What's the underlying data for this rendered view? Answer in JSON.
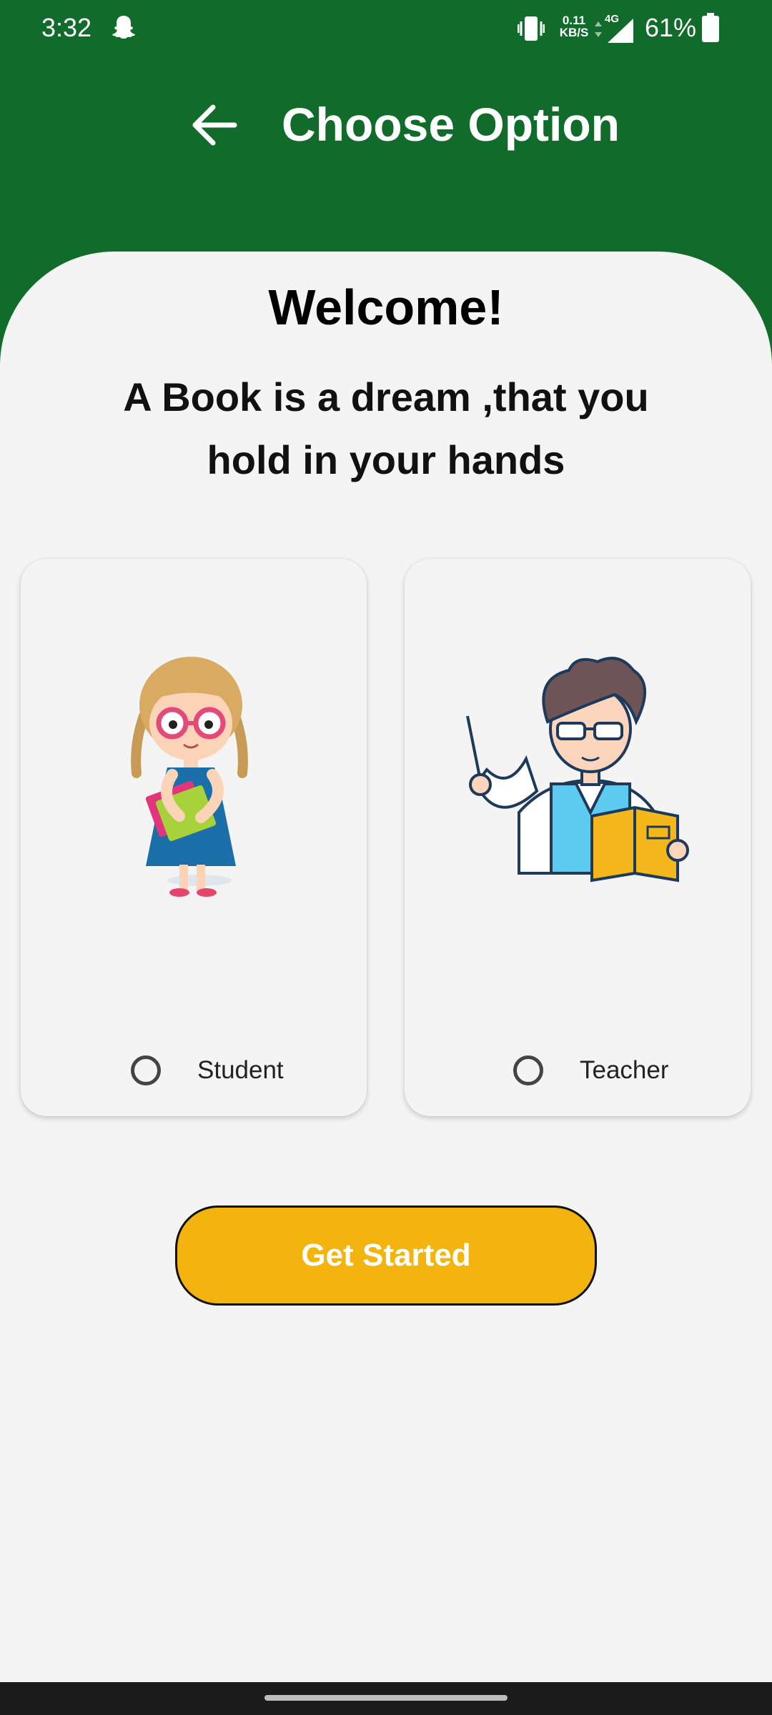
{
  "status_bar": {
    "time": "3:32",
    "speed_value": "0.11",
    "speed_unit": "KB/S",
    "network": "4G",
    "battery": "61%"
  },
  "header": {
    "title": "Choose Option",
    "back_icon": "arrow-left-icon"
  },
  "main": {
    "welcome": "Welcome!",
    "tagline": "A Book is a dream ,that you hold in your hands",
    "options": [
      {
        "label": "Student",
        "illustration": "student-girl-illustration",
        "selected": false
      },
      {
        "label": "Teacher",
        "illustration": "teacher-illustration",
        "selected": false
      }
    ],
    "cta_label": "Get Started"
  },
  "colors": {
    "header_green": "#116b2a",
    "background": "#f4f4f4",
    "cta_yellow": "#f3b40f"
  }
}
